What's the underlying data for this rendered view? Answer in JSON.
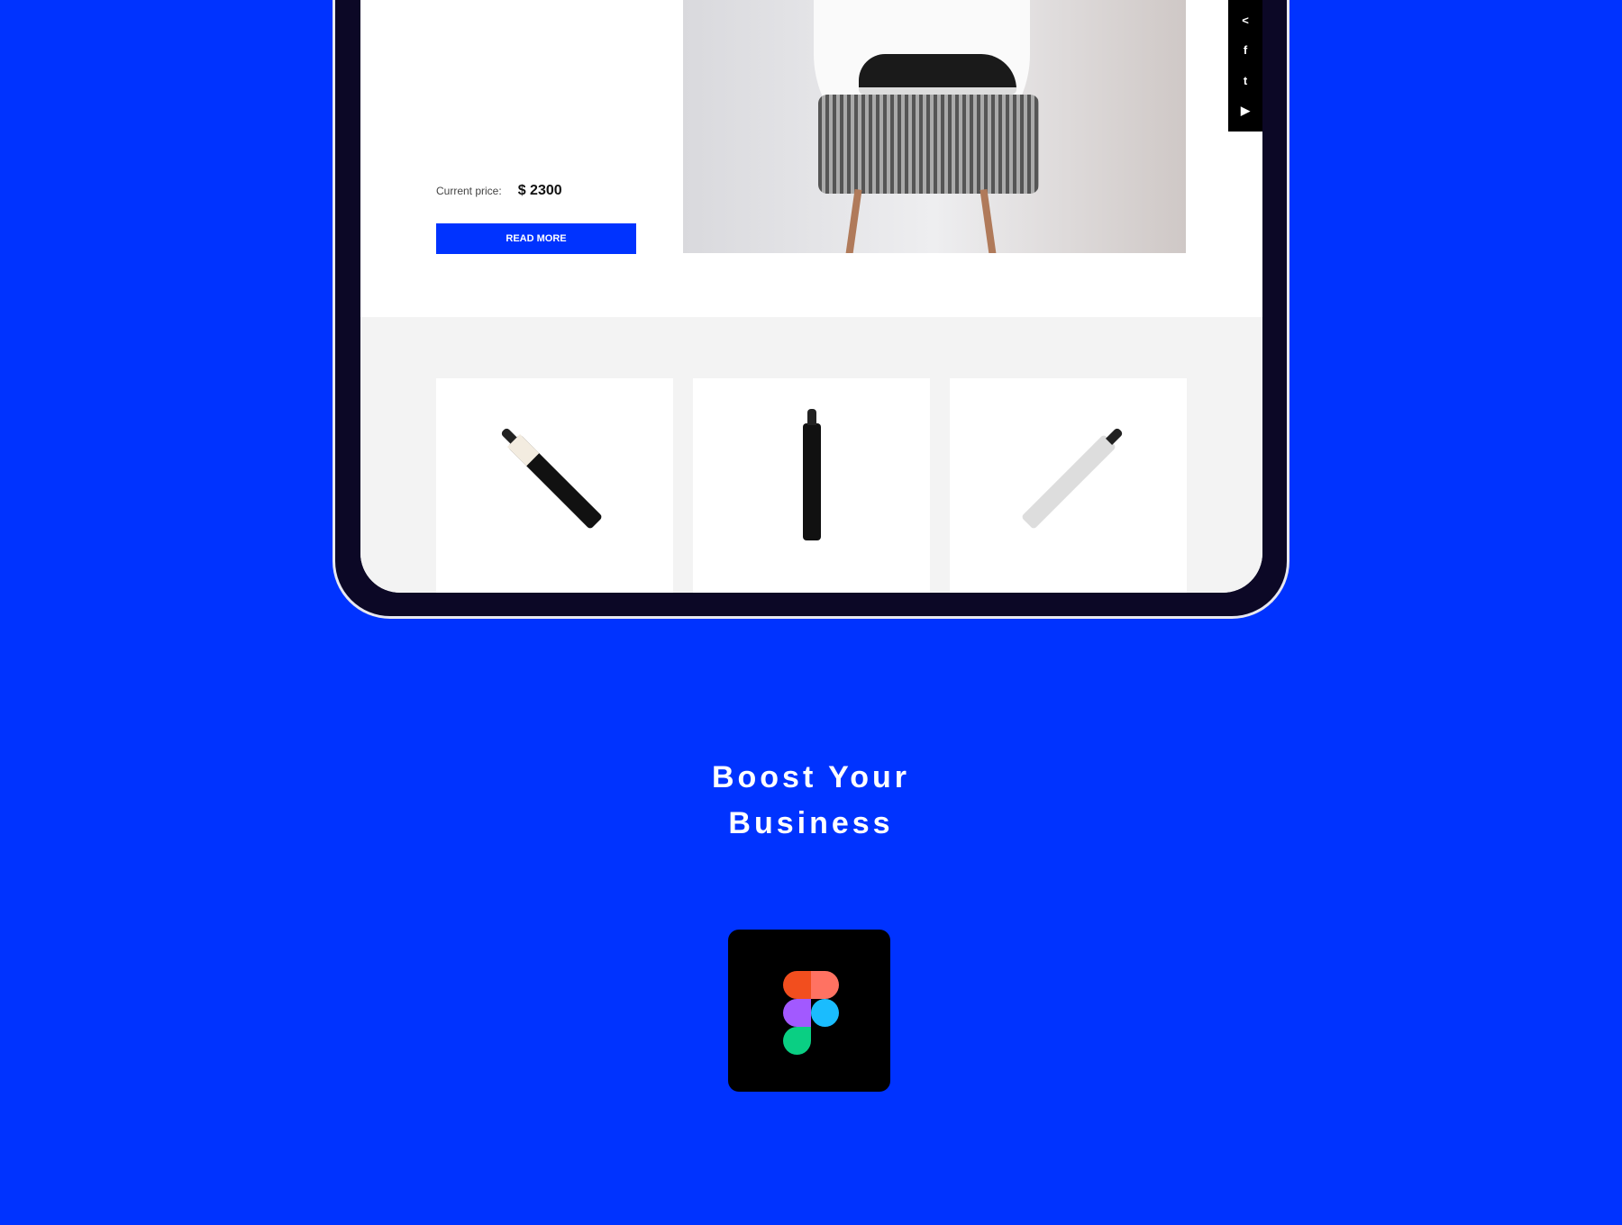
{
  "product": {
    "price_label": "Current price:",
    "price_value": "$ 2300",
    "read_more": "READ MORE"
  },
  "social": [
    "share-icon",
    "facebook-icon",
    "twitter-icon",
    "youtube-icon"
  ],
  "social_glyphs": [
    "<",
    "f",
    "t",
    "▶"
  ],
  "headline": {
    "line1": "Boost Your",
    "line2": "Business"
  },
  "colors": {
    "background": "#0033ff",
    "button": "#0033ff",
    "figma_red": "#f24e1e",
    "figma_coral": "#ff7262",
    "figma_purple": "#a259ff",
    "figma_blue": "#1abcfe",
    "figma_green": "#0acf83"
  }
}
